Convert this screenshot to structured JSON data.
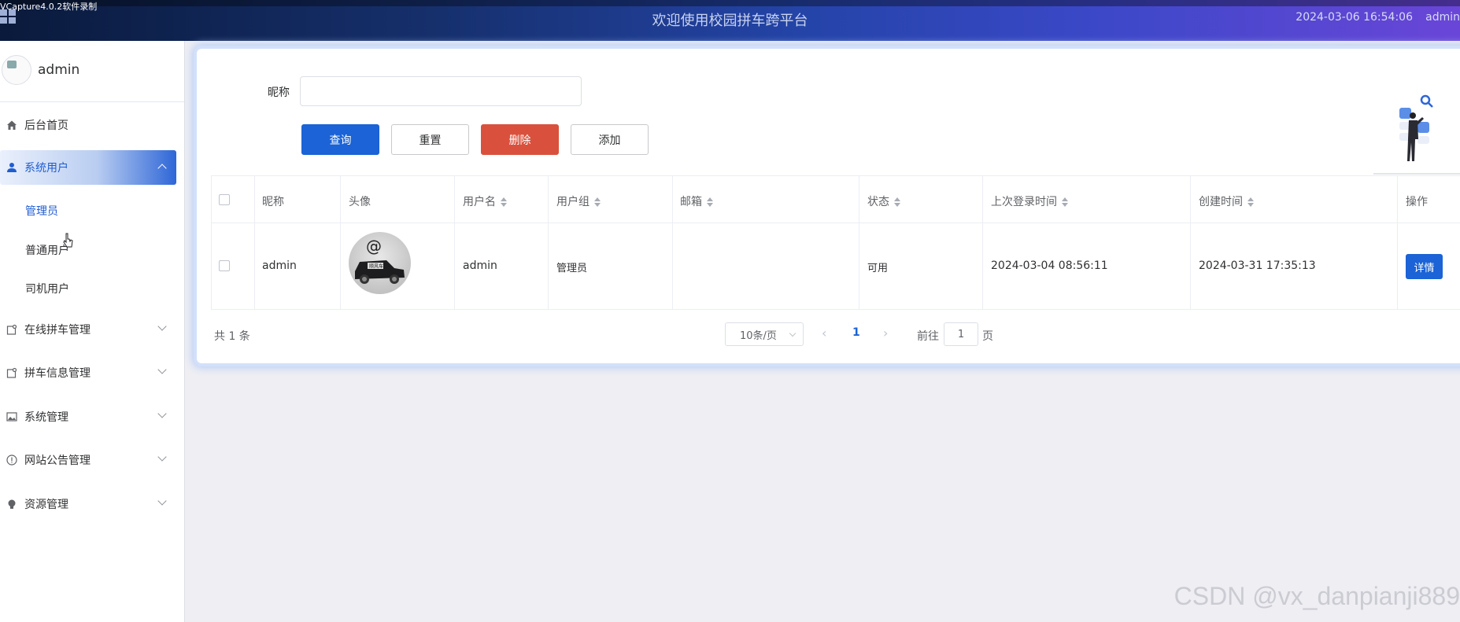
{
  "capture_label": "VCapture4.0.2软件录制",
  "header": {
    "title": "欢迎使用校园拼车跨平台",
    "datetime": "2024-03-06 16:54:06",
    "user": "admin"
  },
  "profile": {
    "name": "admin"
  },
  "sidebar": {
    "items": [
      {
        "label": "后台首页",
        "icon": "home-icon"
      },
      {
        "label": "系统用户",
        "icon": "user-icon",
        "expanded": true,
        "children": [
          "管理员",
          "普通用户",
          "司机用户"
        ],
        "current_child": "管理员"
      },
      {
        "label": "在线拼车管理",
        "icon": "tag-icon"
      },
      {
        "label": "拼车信息管理",
        "icon": "tag-icon"
      },
      {
        "label": "系统管理",
        "icon": "picture-icon"
      },
      {
        "label": "网站公告管理",
        "icon": "info-icon"
      },
      {
        "label": "资源管理",
        "icon": "bulb-icon"
      }
    ]
  },
  "search": {
    "nickname_label": "昵称",
    "nickname_value": "",
    "buttons": {
      "query": "查询",
      "reset": "重置",
      "delete": "删除",
      "add": "添加"
    }
  },
  "table": {
    "headers": [
      "昵称",
      "头像",
      "用户名",
      "用户组",
      "邮箱",
      "状态",
      "上次登录时间",
      "创建时间",
      "操作"
    ],
    "rows": [
      {
        "nickname": "admin",
        "avatar_text": "顺风车",
        "username": "admin",
        "group": "管理员",
        "email": "",
        "status": "可用",
        "last_login": "2024-03-04 08:56:11",
        "created": "2024-03-31 17:35:13",
        "action": "详情"
      }
    ]
  },
  "pagination": {
    "total": "共 1 条",
    "page_size": "10条/页",
    "current_page": "1",
    "goto_label": "前往",
    "goto_value": "1",
    "goto_unit": "页"
  },
  "watermark": "CSDN @vx_danpianji889",
  "colors": {
    "primary": "#1b63d6",
    "danger": "#d9513d",
    "background": "#eeeef3"
  }
}
